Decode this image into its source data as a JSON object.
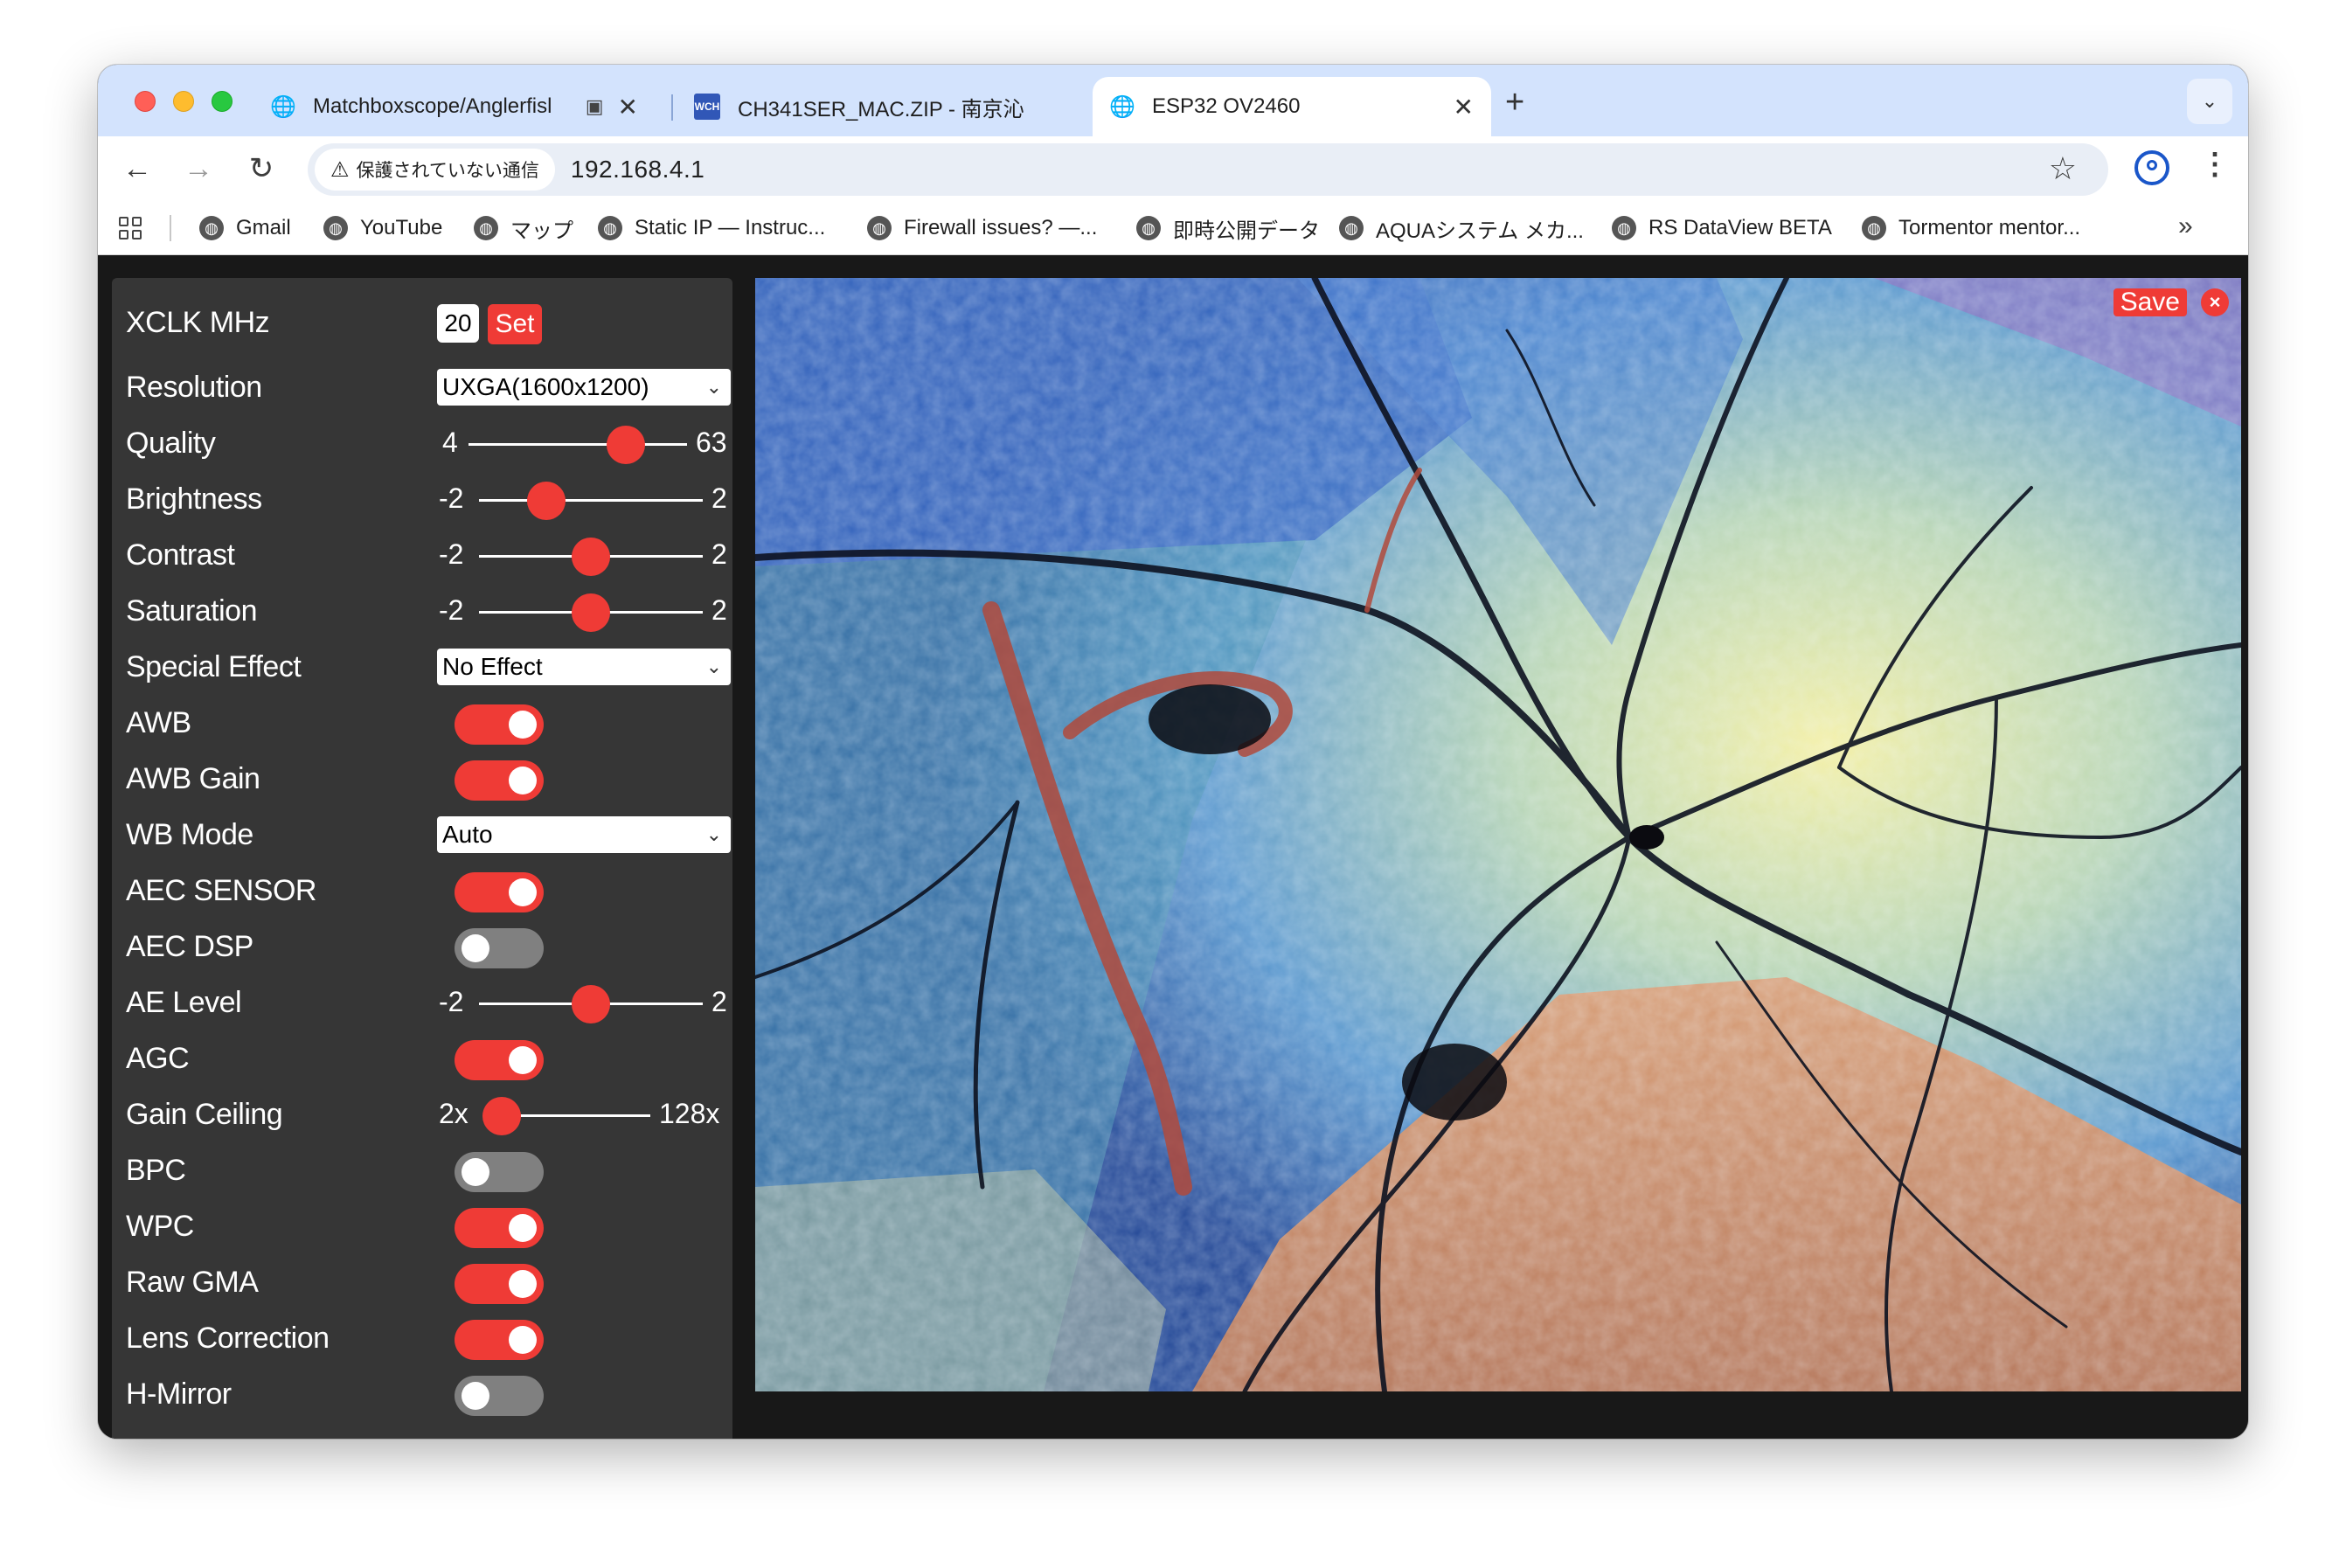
{
  "tabs": [
    {
      "title": "Matchboxscope/Anglerfisl",
      "favicon": "globe-icon",
      "extra_icon": "reader-mode-icon",
      "active": false
    },
    {
      "title": "CH341SER_MAC.ZIP - 南京沁",
      "favicon": "wch-icon",
      "active": false
    },
    {
      "title": "ESP32 OV2460",
      "favicon": "globe-icon",
      "active": true
    }
  ],
  "toolbar": {
    "security_label": "保護されていない通信",
    "url": "192.168.4.1"
  },
  "bookmarks": [
    {
      "label": "Gmail"
    },
    {
      "label": "YouTube"
    },
    {
      "label": "マップ"
    },
    {
      "label": "Static IP — Instruc..."
    },
    {
      "label": "Firewall issues? —..."
    },
    {
      "label": "即時公開データ"
    },
    {
      "label": "AQUAシステム メカ..."
    },
    {
      "label": "RS DataView BETA"
    },
    {
      "label": "Tormentor mentor..."
    }
  ],
  "controls": {
    "xclk": {
      "label": "XCLK MHz",
      "value": "20",
      "button": "Set"
    },
    "resolution": {
      "label": "Resolution",
      "value": "UXGA(1600x1200)"
    },
    "quality": {
      "label": "Quality",
      "min": "4",
      "max": "63",
      "value": 0.72
    },
    "brightness": {
      "label": "Brightness",
      "min": "-2",
      "max": "2",
      "value": 0.3
    },
    "contrast": {
      "label": "Contrast",
      "min": "-2",
      "max": "2",
      "value": 0.5
    },
    "saturation": {
      "label": "Saturation",
      "min": "-2",
      "max": "2",
      "value": 0.5
    },
    "special_effect": {
      "label": "Special Effect",
      "value": "No Effect"
    },
    "awb": {
      "label": "AWB",
      "on": true
    },
    "awb_gain": {
      "label": "AWB Gain",
      "on": true
    },
    "wb_mode": {
      "label": "WB Mode",
      "value": "Auto"
    },
    "aec_sensor": {
      "label": "AEC SENSOR",
      "on": true
    },
    "aec_dsp": {
      "label": "AEC DSP",
      "on": false
    },
    "ae_level": {
      "label": "AE Level",
      "min": "-2",
      "max": "2",
      "value": 0.5
    },
    "agc": {
      "label": "AGC",
      "on": true
    },
    "gain_ceiling": {
      "label": "Gain Ceiling",
      "min": "2x",
      "max": "128x",
      "value": 0.0
    },
    "bpc": {
      "label": "BPC",
      "on": false
    },
    "wpc": {
      "label": "WPC",
      "on": true
    },
    "raw_gma": {
      "label": "Raw GMA",
      "on": true
    },
    "lens_correction": {
      "label": "Lens Correction",
      "on": true
    },
    "h_mirror": {
      "label": "H-Mirror",
      "on": false
    }
  },
  "stream": {
    "save_label": "Save",
    "close_label": "×"
  },
  "colors": {
    "accent": "#ef3b36",
    "panel": "#363636",
    "page_bg": "#181818",
    "tabstrip": "#d3e3fd"
  }
}
